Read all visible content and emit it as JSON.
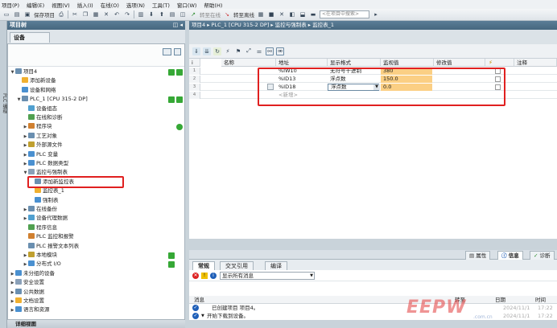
{
  "menu": [
    "项目(P)",
    "编辑(E)",
    "视图(V)",
    "插入(I)",
    "在线(O)",
    "选项(N)",
    "工具(T)",
    "窗口(W)",
    "帮助(H)"
  ],
  "toolbar": {
    "save_project": "保存项目",
    "go_online": "转至在线",
    "go_offline": "转至离线",
    "search_placeholder": "<在项目中搜索>"
  },
  "left_strip_label": "PLC 编程",
  "project_tree": {
    "title": "项目树",
    "devices_tab": "设备",
    "items": [
      {
        "label": "项目4",
        "indent": 0,
        "expanded": true,
        "status": "ok2"
      },
      {
        "label": "添加新设备",
        "indent": 1
      },
      {
        "label": "设备和网络",
        "indent": 1
      },
      {
        "label": "PLC_1 [CPU 315-2 DP]",
        "indent": 1,
        "expanded": true,
        "status": "ok2"
      },
      {
        "label": "设备组态",
        "indent": 2
      },
      {
        "label": "在线和诊断",
        "indent": 2
      },
      {
        "label": "程序块",
        "indent": 2,
        "collapsed": true,
        "status": "dot"
      },
      {
        "label": "工艺对象",
        "indent": 2,
        "collapsed": true
      },
      {
        "label": "外部源文件",
        "indent": 2,
        "collapsed": true
      },
      {
        "label": "PLC 变量",
        "indent": 2,
        "collapsed": true
      },
      {
        "label": "PLC 数据类型",
        "indent": 2,
        "collapsed": true
      },
      {
        "label": "监控与强制表",
        "indent": 2,
        "expanded": true
      },
      {
        "label": "添加新监控表",
        "indent": 3
      },
      {
        "label": "监控表_1",
        "indent": 3
      },
      {
        "label": "强制表",
        "indent": 3
      },
      {
        "label": "在线备份",
        "indent": 2,
        "collapsed": true
      },
      {
        "label": "设备代理数据",
        "indent": 2,
        "collapsed": true
      },
      {
        "label": "程序信息",
        "indent": 2
      },
      {
        "label": "PLC 监控和报警",
        "indent": 2
      },
      {
        "label": "PLC 报警文本列表",
        "indent": 2
      },
      {
        "label": "本地模块",
        "indent": 2,
        "collapsed": true,
        "status": "ok"
      },
      {
        "label": "分布式 I/O",
        "indent": 2,
        "collapsed": true,
        "status": "ok"
      },
      {
        "label": "未分组的设备",
        "indent": 0,
        "collapsed": true
      },
      {
        "label": "安全设置",
        "indent": 0,
        "collapsed": true
      },
      {
        "label": "公共数据",
        "indent": 0,
        "collapsed": true
      },
      {
        "label": "文档设置",
        "indent": 0,
        "collapsed": true
      },
      {
        "label": "语言和资源",
        "indent": 0,
        "collapsed": true
      }
    ]
  },
  "details_view": "详细视图",
  "editor": {
    "breadcrumb": "项目4 ▸ PLC_1 [CPU 315-2 DP] ▸ 监控与强制表 ▸ 监控表_1",
    "columns": [
      "i",
      "名称",
      "地址",
      "显示格式",
      "监视值",
      "修改值",
      "",
      "注释"
    ],
    "rows": [
      {
        "n": "1",
        "address": "%IW10",
        "format": "无符号十进制",
        "monitor": "380"
      },
      {
        "n": "2",
        "address": "%ID13",
        "format": "浮点数",
        "monitor": "150.0"
      },
      {
        "n": "3",
        "address": "%ID18",
        "format": "浮点数",
        "monitor": "0.0"
      },
      {
        "n": "4",
        "address": "<新增>",
        "format": "",
        "monitor": ""
      }
    ]
  },
  "inspector": {
    "top_tabs": [
      "属性",
      "信息",
      "诊断"
    ],
    "sub_tabs": [
      "常规",
      "交叉引用",
      "编译"
    ],
    "filter": "显示所有消息",
    "columns": {
      "message": "消息",
      "goto": "转至",
      "date": "日期",
      "time": "时间"
    },
    "messages": [
      {
        "text": "已创建项目 项目4。",
        "date": "2024/11/1",
        "time": "17:22"
      },
      {
        "text": "开始下载到设备。",
        "date": "2024/11/1",
        "time": "17:22"
      }
    ]
  },
  "watermark": "EEPW",
  "watermark_sub": ".com.cn"
}
